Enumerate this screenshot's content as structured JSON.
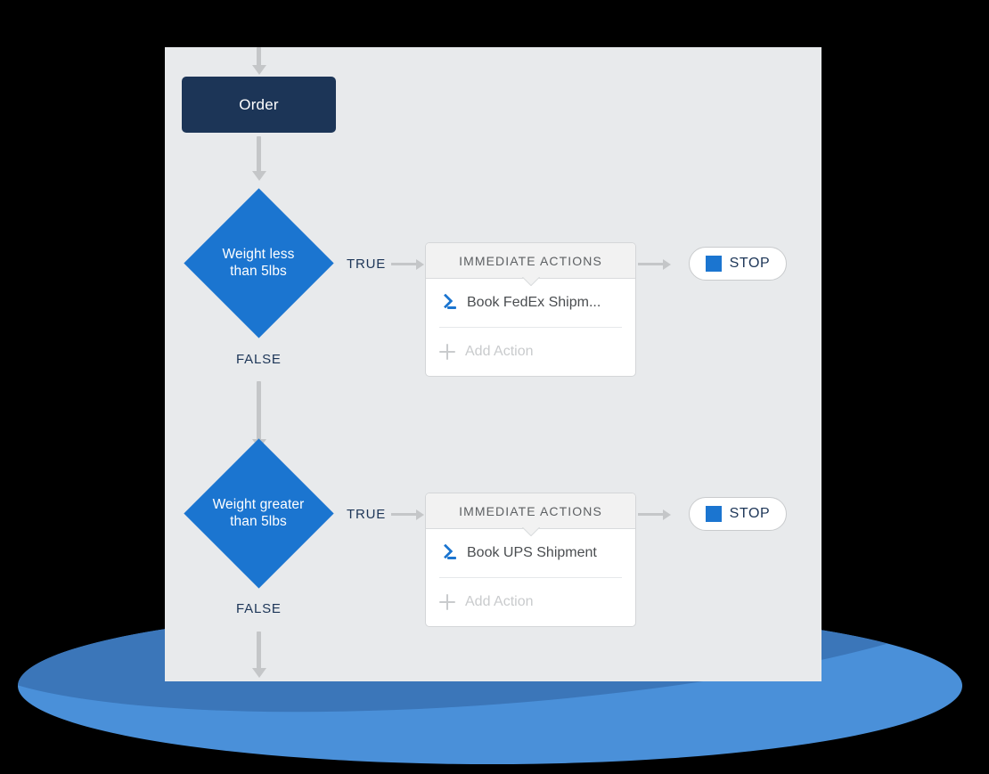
{
  "colors": {
    "canvas_bg": "#e8eaec",
    "start_node": "#1c3557",
    "decision": "#1b75d0",
    "accent_blue": "#1b75d0",
    "connector": "#c4c6c8",
    "muted_text": "#c9cbcd",
    "ellipse_light": "#4a90d9",
    "ellipse_dark": "#3b76b9",
    "page_bg": "#000000"
  },
  "flow": {
    "start_node": {
      "label": "Order"
    },
    "branches": [
      {
        "decision": {
          "line1": "Weight less",
          "line2": "than 5lbs"
        },
        "true_label": "TRUE",
        "false_label": "FALSE",
        "card": {
          "header": "IMMEDIATE ACTIONS",
          "action": {
            "icon": "terminal-prompt-icon",
            "label": "Book FedEx Shipm..."
          },
          "add": {
            "icon": "plus-icon",
            "label": "Add Action"
          }
        },
        "stop": {
          "icon": "stop-square-icon",
          "label": "STOP"
        }
      },
      {
        "decision": {
          "line1": "Weight greater",
          "line2": "than 5lbs"
        },
        "true_label": "TRUE",
        "false_label": "FALSE",
        "card": {
          "header": "IMMEDIATE ACTIONS",
          "action": {
            "icon": "terminal-prompt-icon",
            "label": "Book UPS Shipment"
          },
          "add": {
            "icon": "plus-icon",
            "label": "Add Action"
          }
        },
        "stop": {
          "icon": "stop-square-icon",
          "label": "STOP"
        }
      }
    ]
  }
}
